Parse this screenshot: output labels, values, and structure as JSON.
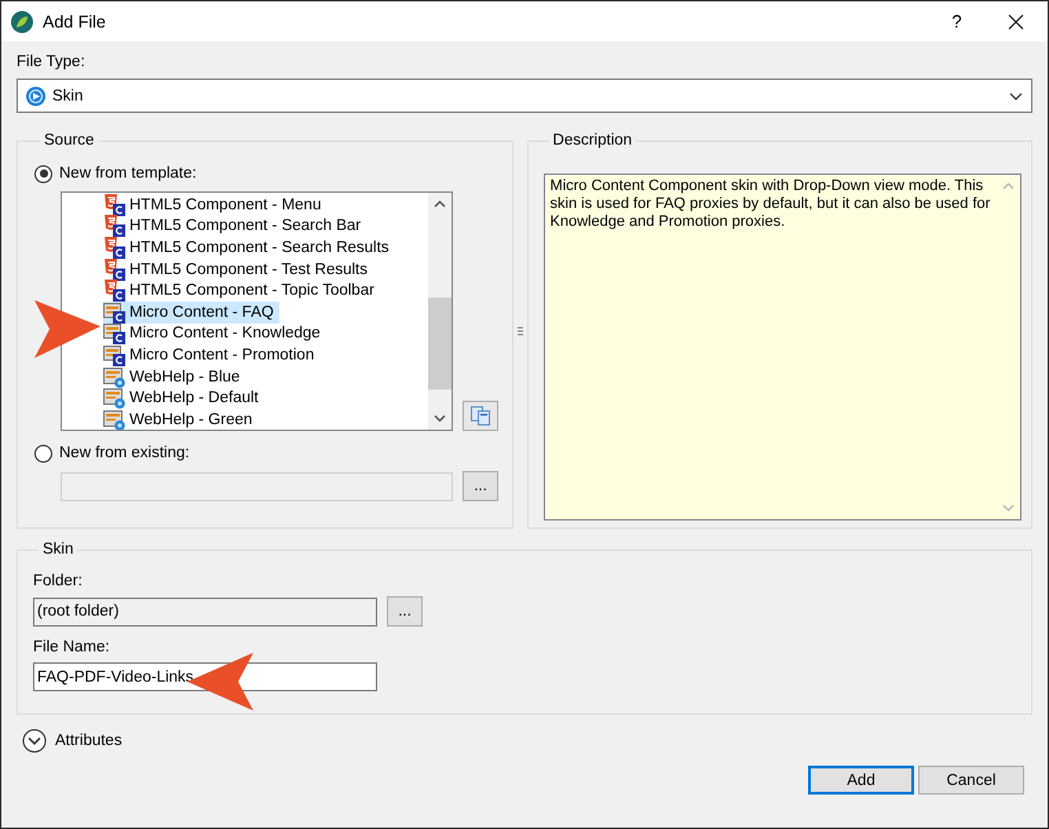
{
  "window": {
    "title": "Add File",
    "help_button": "?"
  },
  "file_type": {
    "label": "File Type:",
    "value": "Skin"
  },
  "source": {
    "title": "Source",
    "options": [
      {
        "label": "New from template:",
        "selected": true
      },
      {
        "label": "New from existing:",
        "selected": false
      }
    ],
    "templates": [
      {
        "kind": "html5",
        "label": "HTML5 Component - Menu",
        "selected": false
      },
      {
        "kind": "html5",
        "label": "HTML5 Component - Search Bar",
        "selected": false
      },
      {
        "kind": "html5",
        "label": "HTML5 Component - Search Results",
        "selected": false
      },
      {
        "kind": "html5",
        "label": "HTML5 Component - Test Results",
        "selected": false
      },
      {
        "kind": "html5",
        "label": "HTML5 Component - Topic Toolbar",
        "selected": false
      },
      {
        "kind": "micro",
        "label": "Micro Content - FAQ",
        "selected": true
      },
      {
        "kind": "micro",
        "label": "Micro Content - Knowledge",
        "selected": false
      },
      {
        "kind": "micro",
        "label": "Micro Content - Promotion",
        "selected": false
      },
      {
        "kind": "webhelp",
        "label": "WebHelp - Blue",
        "selected": false
      },
      {
        "kind": "webhelp",
        "label": "WebHelp - Default",
        "selected": false
      },
      {
        "kind": "webhelp",
        "label": "WebHelp - Green",
        "selected": false
      }
    ],
    "existing_browse": "..."
  },
  "description": {
    "title": "Description",
    "text": "Micro Content Component skin with Drop-Down view mode. This skin is used for FAQ proxies by default, but it can also be used for Knowledge and Promotion proxies."
  },
  "skin": {
    "title": "Skin",
    "folder_label": "Folder:",
    "folder_value": "(root folder)",
    "folder_browse": "...",
    "file_name_label": "File Name:",
    "file_name_value": "FAQ-PDF-Video-Links"
  },
  "attributes": {
    "label": "Attributes",
    "expanded": false
  },
  "buttons": [
    {
      "label": "Add",
      "default": true
    },
    {
      "label": "Cancel",
      "default": false
    }
  ]
}
